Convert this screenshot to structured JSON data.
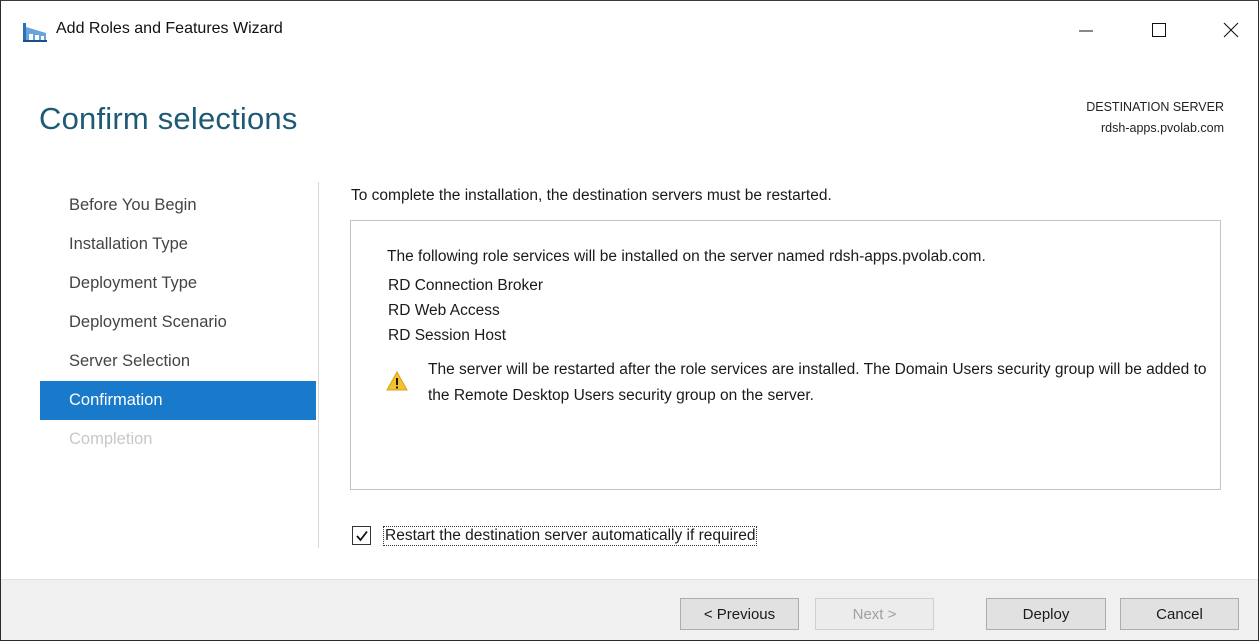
{
  "window": {
    "title": "Add Roles and Features Wizard"
  },
  "header": {
    "page_title": "Confirm selections",
    "destination_label": "DESTINATION SERVER",
    "destination_server": "rdsh-apps.pvolab.com"
  },
  "nav": {
    "items": [
      {
        "label": "Before You Begin",
        "state": "normal"
      },
      {
        "label": "Installation Type",
        "state": "normal"
      },
      {
        "label": "Deployment Type",
        "state": "normal"
      },
      {
        "label": "Deployment Scenario",
        "state": "normal"
      },
      {
        "label": "Server Selection",
        "state": "normal"
      },
      {
        "label": "Confirmation",
        "state": "active"
      },
      {
        "label": "Completion",
        "state": "disabled"
      }
    ]
  },
  "main": {
    "restart_note": "To complete the installation, the destination servers must be restarted.",
    "summary": {
      "intro": "The following role services will be installed on the server named rdsh-apps.pvolab.com.",
      "roles": [
        "RD Connection Broker",
        "RD Web Access",
        "RD Session Host"
      ],
      "warning_icon": "warning-triangle-icon",
      "warning": "The server will be restarted after the role services are installed. The Domain Users security group will be added to the Remote Desktop Users security group on the server."
    },
    "restart_checkbox": {
      "label": "Restart the destination server automatically if required",
      "checked": true
    }
  },
  "footer": {
    "previous_label": "< Previous",
    "next_label": "Next >",
    "deploy_label": "Deploy",
    "cancel_label": "Cancel"
  },
  "colors": {
    "accent": "#1979ca",
    "title": "#1e5a73",
    "warning": "#f2c12e"
  }
}
